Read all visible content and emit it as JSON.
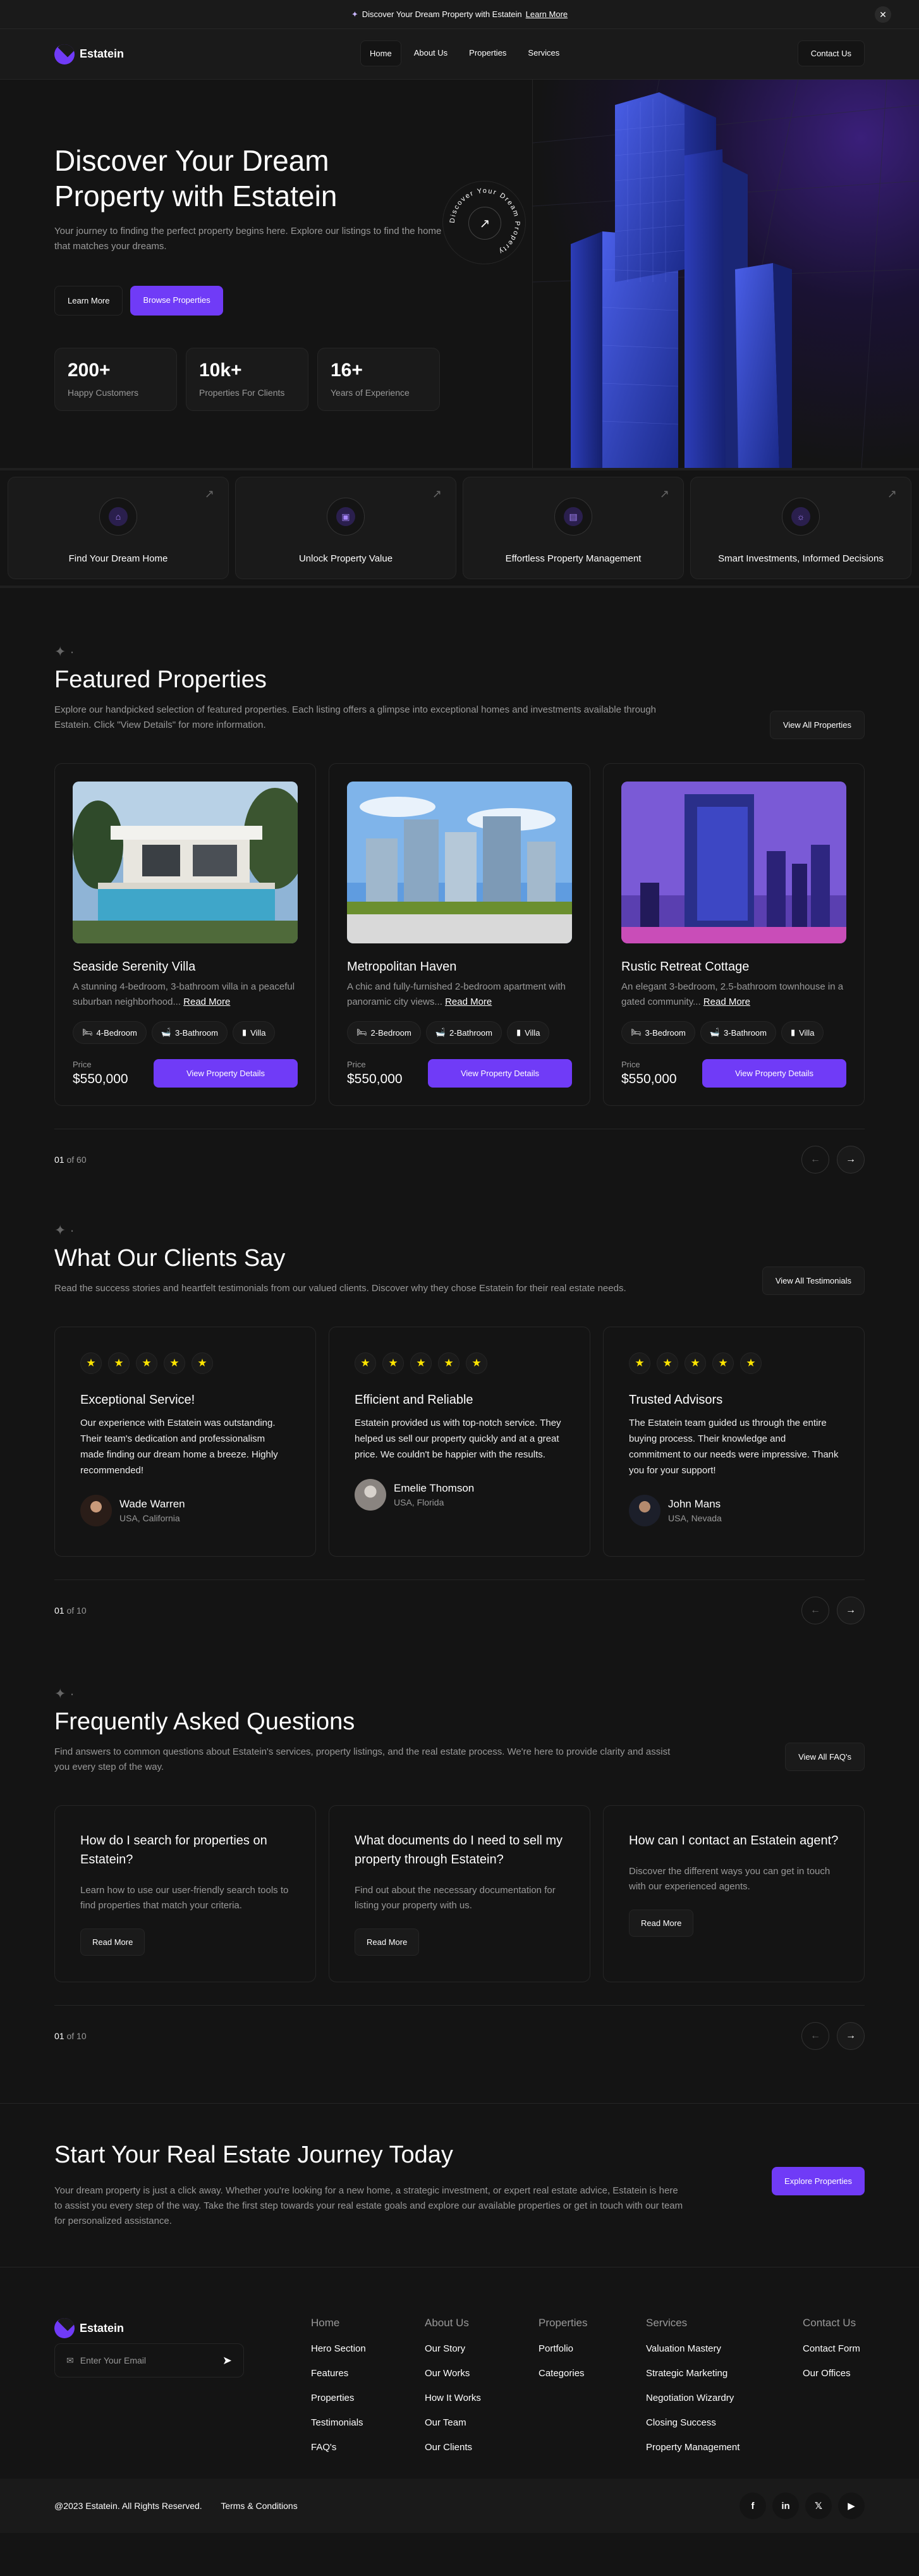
{
  "banner": {
    "text": "Discover Your Dream Property with Estatein",
    "link": "Learn More"
  },
  "nav": {
    "brand": "Estatein",
    "items": [
      {
        "label": "Home",
        "active": true
      },
      {
        "label": "About Us",
        "active": false
      },
      {
        "label": "Properties",
        "active": false
      },
      {
        "label": "Services",
        "active": false
      }
    ],
    "contact": "Contact Us"
  },
  "hero": {
    "title": "Discover Your Dream Property with Estatein",
    "subtitle": "Your journey to finding the perfect property begins here. Explore our listings to find the home that matches your dreams.",
    "learn_more": "Learn More",
    "browse": "Browse Properties",
    "badge_text": "Discover Your Dream Property",
    "stats": [
      {
        "num": "200+",
        "label": "Happy Customers"
      },
      {
        "num": "10k+",
        "label": "Properties For Clients"
      },
      {
        "num": "16+",
        "label": "Years of Experience"
      }
    ]
  },
  "features": [
    {
      "title": "Find Your Dream Home",
      "icon": "home-icon"
    },
    {
      "title": "Unlock Property Value",
      "icon": "camera-icon"
    },
    {
      "title": "Effortless Property Management",
      "icon": "building-icon"
    },
    {
      "title": "Smart Investments, Informed Decisions",
      "icon": "sun-icon"
    }
  ],
  "featured": {
    "title": "Featured Properties",
    "subtitle": "Explore our handpicked selection of featured properties. Each listing offers a glimpse into exceptional homes and investments available through Estatein. Click \"View Details\" for more information.",
    "view_all": "View All Properties",
    "read_more": "Read More",
    "price_label": "Price",
    "button": "View Property Details",
    "properties": [
      {
        "name": "Seaside Serenity Villa",
        "desc": "A stunning 4-bedroom, 3-bathroom villa in a peaceful suburban neighborhood...",
        "bed": "4-Bedroom",
        "bath": "3-Bathroom",
        "type": "Villa",
        "price": "$550,000"
      },
      {
        "name": "Metropolitan Haven",
        "desc": "A chic and fully-furnished 2-bedroom apartment with panoramic city views...",
        "bed": "2-Bedroom",
        "bath": "2-Bathroom",
        "type": "Villa",
        "price": "$550,000"
      },
      {
        "name": "Rustic Retreat Cottage",
        "desc": "An elegant 3-bedroom, 2.5-bathroom townhouse in a gated community...",
        "bed": "3-Bedroom",
        "bath": "3-Bathroom",
        "type": "Villa",
        "price": "$550,000"
      }
    ],
    "pager": {
      "current": "01",
      "total": " of 60"
    }
  },
  "testimonials": {
    "title": "What Our Clients Say",
    "subtitle": "Read the success stories and heartfelt testimonials from our valued clients. Discover why they chose Estatein for their real estate needs.",
    "view_all": "View All Testimonials",
    "items": [
      {
        "title": "Exceptional Service!",
        "text": "Our experience with Estatein was outstanding. Their team's dedication and professionalism made finding our dream home a breeze. Highly recommended!",
        "name": "Wade Warren",
        "loc": "USA, California"
      },
      {
        "title": "Efficient and Reliable",
        "text": "Estatein provided us with top-notch service. They helped us sell our property quickly and at a great price. We couldn't be happier with the results.",
        "name": "Emelie Thomson",
        "loc": "USA, Florida"
      },
      {
        "title": "Trusted Advisors",
        "text": "The Estatein team guided us through the entire buying process. Their knowledge and commitment to our needs were impressive. Thank you for your support!",
        "name": "John Mans",
        "loc": "USA, Nevada"
      }
    ],
    "pager": {
      "current": "01",
      "total": " of 10"
    }
  },
  "faq": {
    "title": "Frequently Asked Questions",
    "subtitle": "Find answers to common questions about Estatein's services, property listings, and the real estate process. We're here to provide clarity and assist you every step of the way.",
    "view_all": "View All FAQ's",
    "read_more": "Read More",
    "items": [
      {
        "q": "How do I search for properties on Estatein?",
        "a": "Learn how to use our user-friendly search tools to find properties that match your criteria."
      },
      {
        "q": "What documents do I need to sell my property through Estatein?",
        "a": "Find out about the necessary documentation for listing your property with us."
      },
      {
        "q": "How can I contact an Estatein agent?",
        "a": "Discover the different ways you can get in touch with our experienced agents."
      }
    ],
    "pager": {
      "current": "01",
      "total": " of 10"
    }
  },
  "cta": {
    "title": "Start Your Real Estate Journey Today",
    "text": "Your dream property is just a click away. Whether you're looking for a new home, a strategic investment, or expert real estate advice, Estatein is here to assist you every step of the way. Take the first step towards your real estate goals and explore our available properties or get in touch with our team for personalized assistance.",
    "button": "Explore Properties"
  },
  "footer": {
    "brand": "Estatein",
    "email_placeholder": "Enter Your Email",
    "columns": [
      {
        "head": "Home",
        "links": [
          "Hero Section",
          "Features",
          "Properties",
          "Testimonials",
          "FAQ's"
        ]
      },
      {
        "head": "About Us",
        "links": [
          "Our Story",
          "Our Works",
          "How It Works",
          "Our Team",
          "Our Clients"
        ]
      },
      {
        "head": "Properties",
        "links": [
          "Portfolio",
          "Categories"
        ]
      },
      {
        "head": "Services",
        "links": [
          "Valuation Mastery",
          "Strategic Marketing",
          "Negotiation Wizardry",
          "Closing Success",
          "Property Management"
        ]
      },
      {
        "head": "Contact Us",
        "links": [
          "Contact Form",
          "Our Offices"
        ]
      }
    ],
    "copyright": "@2023 Estatein. All Rights Reserved.",
    "terms": "Terms & Conditions",
    "socials": [
      "facebook-icon",
      "linkedin-icon",
      "twitter-icon",
      "youtube-icon"
    ]
  },
  "colors": {
    "accent": "#703bf7",
    "bg": "#141414",
    "card": "#1a1a1a",
    "border": "#262626",
    "star": "#ffe500"
  }
}
